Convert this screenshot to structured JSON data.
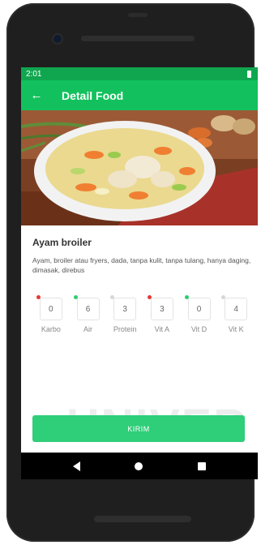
{
  "status_bar": {
    "time": "2:01"
  },
  "app_bar": {
    "title": "Detail Food",
    "back_icon": "←"
  },
  "food": {
    "name": "Ayam broiler",
    "description": "Ayam, broiler atau fryers, dada, tanpa kulit, tanpa tulang, hanya daging, dimasak, direbus"
  },
  "nutrients": [
    {
      "label": "Karbo",
      "value": "0",
      "indicator_color": "#e53935"
    },
    {
      "label": "Air",
      "value": "6",
      "indicator_color": "#2ecc71"
    },
    {
      "label": "Protein",
      "value": "3",
      "indicator_color": "#d7d7d7"
    },
    {
      "label": "Vit A",
      "value": "3",
      "indicator_color": "#e53935"
    },
    {
      "label": "Vit D",
      "value": "0",
      "indicator_color": "#2ecc71"
    },
    {
      "label": "Vit K",
      "value": "4",
      "indicator_color": "#d7d7d7"
    }
  ],
  "submit_button": {
    "label": "KIRIM"
  },
  "watermark": "UNIVER",
  "colors": {
    "accent": "#12c15d",
    "status_bar": "#10a64f",
    "button": "#2fce79"
  }
}
